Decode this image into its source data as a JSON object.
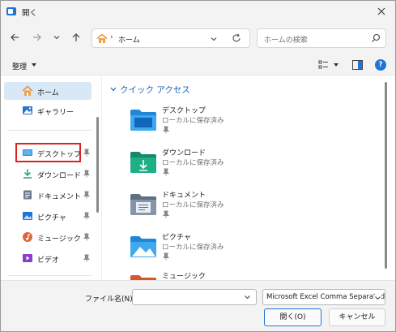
{
  "window": {
    "title": "開く"
  },
  "address_bar": {
    "location": "ホーム",
    "separator": "›"
  },
  "search": {
    "placeholder": "ホームの検索"
  },
  "command_bar": {
    "organize_label": "整理",
    "help_label": "?"
  },
  "sidebar": {
    "items": [
      {
        "label": "ホーム",
        "icon": "home-icon",
        "selected": true,
        "pinned": false
      },
      {
        "label": "ギャラリー",
        "icon": "gallery-icon",
        "selected": false,
        "pinned": false
      },
      {
        "label": "デスクトップ",
        "icon": "desktop-icon",
        "selected": false,
        "pinned": true
      },
      {
        "label": "ダウンロード",
        "icon": "download-icon",
        "selected": false,
        "pinned": true
      },
      {
        "label": "ドキュメント",
        "icon": "documents-icon",
        "selected": false,
        "pinned": true
      },
      {
        "label": "ピクチャ",
        "icon": "pictures-icon",
        "selected": false,
        "pinned": true
      },
      {
        "label": "ミュージック",
        "icon": "music-icon",
        "selected": false,
        "pinned": true
      },
      {
        "label": "ビデオ",
        "icon": "videos-icon",
        "selected": false,
        "pinned": true
      }
    ]
  },
  "quick_access": {
    "header": "クイック アクセス",
    "folders": [
      {
        "name": "デスクトップ",
        "sub": "ローカルに保存済み",
        "icon": "desktop-folder-icon"
      },
      {
        "name": "ダウンロード",
        "sub": "ローカルに保存済み",
        "icon": "download-folder-icon"
      },
      {
        "name": "ドキュメント",
        "sub": "ローカルに保存済み",
        "icon": "documents-folder-icon"
      },
      {
        "name": "ピクチャ",
        "sub": "ローカルに保存済み",
        "icon": "pictures-folder-icon"
      },
      {
        "name": "ミュージック",
        "sub": "",
        "icon": "music-folder-icon"
      }
    ]
  },
  "bottom": {
    "filename_label": "ファイル名(N):",
    "filename_value": "",
    "filetype_value": "Microsoft Excel Comma Separated",
    "open_label": "開く(O)",
    "cancel_label": "キャンセル"
  },
  "colors": {
    "accent": "#1e74d9",
    "highlight": "#e02020",
    "selected_bg": "#d9e8f7",
    "header_blue": "#1a5fb4"
  }
}
